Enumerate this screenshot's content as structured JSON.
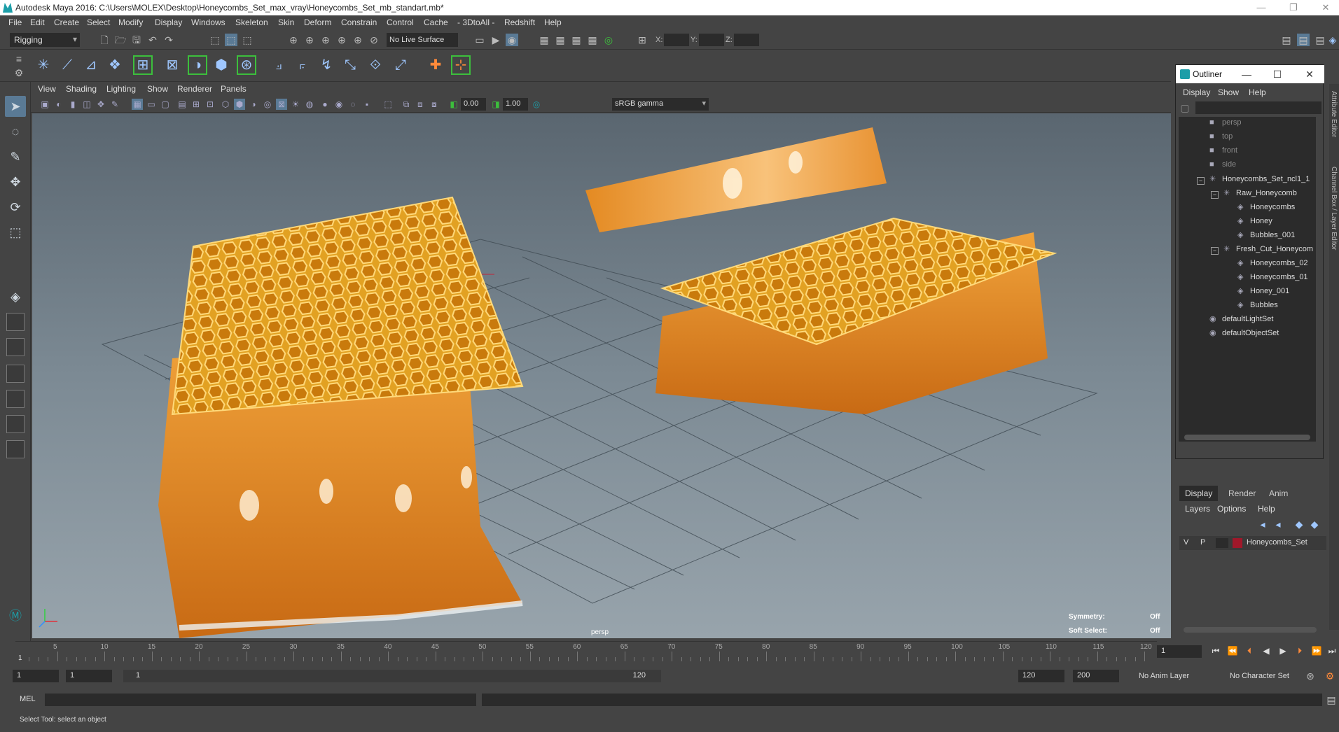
{
  "window": {
    "title": "Autodesk Maya 2016: C:\\Users\\MOLEX\\Desktop\\Honeycombs_Set_max_vray\\Honeycombs_Set_mb_standart.mb*"
  },
  "menubar": [
    "File",
    "Edit",
    "Create",
    "Select",
    "Modify",
    "Display",
    "Windows",
    "Skeleton",
    "Skin",
    "Deform",
    "Constrain",
    "Control",
    "Cache",
    "- 3DtoAll -",
    "Redshift",
    "Help"
  ],
  "statusline": {
    "mode": "Rigging",
    "live_surface": "No Live Surface",
    "x_label": "X:",
    "y_label": "Y:",
    "z_label": "Z:"
  },
  "panel": {
    "menu": [
      "View",
      "Shading",
      "Lighting",
      "Show",
      "Renderer",
      "Panels"
    ],
    "exposure": "0.00",
    "gamma": "1.00",
    "color_space": "sRGB gamma"
  },
  "viewport": {
    "camera": "persp",
    "symmetry_label": "Symmetry:",
    "symmetry_value": "Off",
    "soft_select_label": "Soft Select:",
    "soft_select_value": "Off"
  },
  "outliner": {
    "title": "Outliner",
    "menu": [
      "Display",
      "Show",
      "Help"
    ],
    "items": [
      {
        "label": "persp",
        "icon": "camera-icon",
        "dim": true
      },
      {
        "label": "top",
        "icon": "camera-icon",
        "dim": true
      },
      {
        "label": "front",
        "icon": "camera-icon",
        "dim": true
      },
      {
        "label": "side",
        "icon": "camera-icon",
        "dim": true
      },
      {
        "label": "Honeycombs_Set_ncl1_1",
        "icon": "joint-icon",
        "dim": false
      },
      {
        "label": "Raw_Honeycomb",
        "icon": "joint-icon",
        "dim": false
      },
      {
        "label": "Honeycombs",
        "icon": "mesh-icon",
        "dim": false
      },
      {
        "label": "Honey",
        "icon": "mesh-icon",
        "dim": false
      },
      {
        "label": "Bubbles_001",
        "icon": "mesh-icon",
        "dim": false
      },
      {
        "label": "Fresh_Cut_Honeycom",
        "icon": "joint-icon",
        "dim": false
      },
      {
        "label": "Honeycombs_02",
        "icon": "mesh-icon",
        "dim": false
      },
      {
        "label": "Honeycombs_01",
        "icon": "mesh-icon",
        "dim": false
      },
      {
        "label": "Honey_001",
        "icon": "mesh-icon",
        "dim": false
      },
      {
        "label": "Bubbles",
        "icon": "mesh-icon",
        "dim": false
      },
      {
        "label": "defaultLightSet",
        "icon": "set-icon",
        "dim": false
      },
      {
        "label": "defaultObjectSet",
        "icon": "set-icon",
        "dim": false
      }
    ]
  },
  "side_tabs": {
    "attribute_editor": "Attribute Editor",
    "channel_box": "Channel Box / Layer Editor"
  },
  "layers": {
    "tabs": [
      "Display",
      "Render",
      "Anim"
    ],
    "menu": [
      "Layers",
      "Options",
      "Help"
    ],
    "row": {
      "v": "V",
      "p": "P",
      "name": "Honeycombs_Set",
      "color": "#a0182a"
    }
  },
  "timeslider": {
    "ticks": [
      5,
      10,
      15,
      20,
      25,
      30,
      35,
      40,
      45,
      50,
      55,
      60,
      65,
      70,
      75,
      80,
      85,
      90,
      95,
      100,
      105,
      110,
      115,
      120
    ],
    "start": "1",
    "current_frame": "1"
  },
  "range": {
    "start": "1",
    "playback_start": "1",
    "slider_left": "1",
    "slider_right": "120",
    "playback_end": "120",
    "end": "200",
    "anim_layer": "No Anim Layer",
    "character_set": "No Character Set"
  },
  "cmdline": {
    "label": "MEL"
  },
  "helpline": {
    "text": "Select Tool: select an object"
  }
}
